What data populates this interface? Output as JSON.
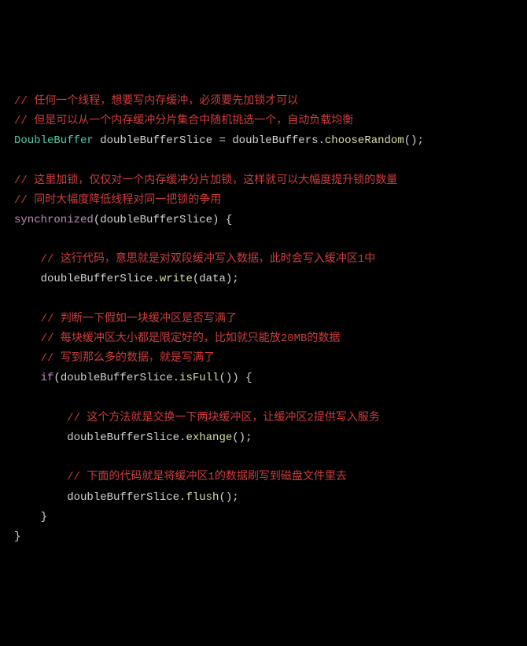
{
  "code": {
    "lines": [
      {
        "segments": [
          {
            "cls": "comment",
            "text": "// 任何一个线程，想要写内存缓冲，必须要先加锁才可以"
          }
        ]
      },
      {
        "segments": [
          {
            "cls": "comment",
            "text": "// 但是可以从一个内存缓冲分片集合中随机挑选一个，自动负载均衡"
          }
        ]
      },
      {
        "segments": [
          {
            "cls": "type",
            "text": "DoubleBuffer"
          },
          {
            "cls": "punct",
            "text": " "
          },
          {
            "cls": "identifier",
            "text": "doubleBufferSlice"
          },
          {
            "cls": "punct",
            "text": " = "
          },
          {
            "cls": "identifier",
            "text": "doubleBuffers"
          },
          {
            "cls": "punct",
            "text": "."
          },
          {
            "cls": "method",
            "text": "chooseRandom"
          },
          {
            "cls": "punct",
            "text": "();"
          }
        ]
      },
      {
        "segments": [
          {
            "cls": "punct",
            "text": ""
          }
        ]
      },
      {
        "segments": [
          {
            "cls": "comment",
            "text": "// 这里加锁，仅仅对一个内存缓冲分片加锁，这样就可以大幅度提升锁的数量"
          }
        ]
      },
      {
        "segments": [
          {
            "cls": "comment",
            "text": "// 同时大幅度降低线程对同一把锁的争用"
          }
        ]
      },
      {
        "segments": [
          {
            "cls": "keyword",
            "text": "synchronized"
          },
          {
            "cls": "punct",
            "text": "(doubleBufferSlice) {"
          }
        ]
      },
      {
        "segments": [
          {
            "cls": "punct",
            "text": ""
          }
        ]
      },
      {
        "segments": [
          {
            "cls": "punct",
            "text": "    "
          },
          {
            "cls": "comment",
            "text": "// 这行代码，意思就是对双段缓冲写入数据，此时会写入缓冲区1中"
          }
        ]
      },
      {
        "segments": [
          {
            "cls": "punct",
            "text": "    "
          },
          {
            "cls": "identifier",
            "text": "doubleBufferSlice"
          },
          {
            "cls": "punct",
            "text": "."
          },
          {
            "cls": "method",
            "text": "write"
          },
          {
            "cls": "punct",
            "text": "(data);"
          }
        ]
      },
      {
        "segments": [
          {
            "cls": "punct",
            "text": ""
          }
        ]
      },
      {
        "segments": [
          {
            "cls": "punct",
            "text": "    "
          },
          {
            "cls": "comment",
            "text": "// 判断一下假如一块缓冲区是否写满了"
          }
        ]
      },
      {
        "segments": [
          {
            "cls": "punct",
            "text": "    "
          },
          {
            "cls": "comment",
            "text": "// 每块缓冲区大小都是限定好的，比如就只能放20MB的数据"
          }
        ]
      },
      {
        "segments": [
          {
            "cls": "punct",
            "text": "    "
          },
          {
            "cls": "comment",
            "text": "// 写到那么多的数据，就是写满了"
          }
        ]
      },
      {
        "segments": [
          {
            "cls": "punct",
            "text": "    "
          },
          {
            "cls": "keyword",
            "text": "if"
          },
          {
            "cls": "punct",
            "text": "(doubleBufferSlice."
          },
          {
            "cls": "method",
            "text": "isFull"
          },
          {
            "cls": "punct",
            "text": "()) {"
          }
        ]
      },
      {
        "segments": [
          {
            "cls": "punct",
            "text": ""
          }
        ]
      },
      {
        "segments": [
          {
            "cls": "punct",
            "text": "        "
          },
          {
            "cls": "comment",
            "text": "// 这个方法就是交换一下两块缓冲区，让缓冲区2提供写入服务"
          }
        ]
      },
      {
        "segments": [
          {
            "cls": "punct",
            "text": "        "
          },
          {
            "cls": "identifier",
            "text": "doubleBufferSlice"
          },
          {
            "cls": "punct",
            "text": "."
          },
          {
            "cls": "method",
            "text": "exhange"
          },
          {
            "cls": "punct",
            "text": "();"
          }
        ]
      },
      {
        "segments": [
          {
            "cls": "punct",
            "text": ""
          }
        ]
      },
      {
        "segments": [
          {
            "cls": "punct",
            "text": "        "
          },
          {
            "cls": "comment",
            "text": "// 下面的代码就是将缓冲区1的数据刷写到磁盘文件里去"
          }
        ]
      },
      {
        "segments": [
          {
            "cls": "punct",
            "text": "        "
          },
          {
            "cls": "identifier",
            "text": "doubleBufferSlice"
          },
          {
            "cls": "punct",
            "text": "."
          },
          {
            "cls": "method",
            "text": "flush"
          },
          {
            "cls": "punct",
            "text": "();"
          }
        ]
      },
      {
        "segments": [
          {
            "cls": "punct",
            "text": "    }"
          }
        ]
      },
      {
        "segments": [
          {
            "cls": "punct",
            "text": "}"
          }
        ]
      }
    ]
  }
}
